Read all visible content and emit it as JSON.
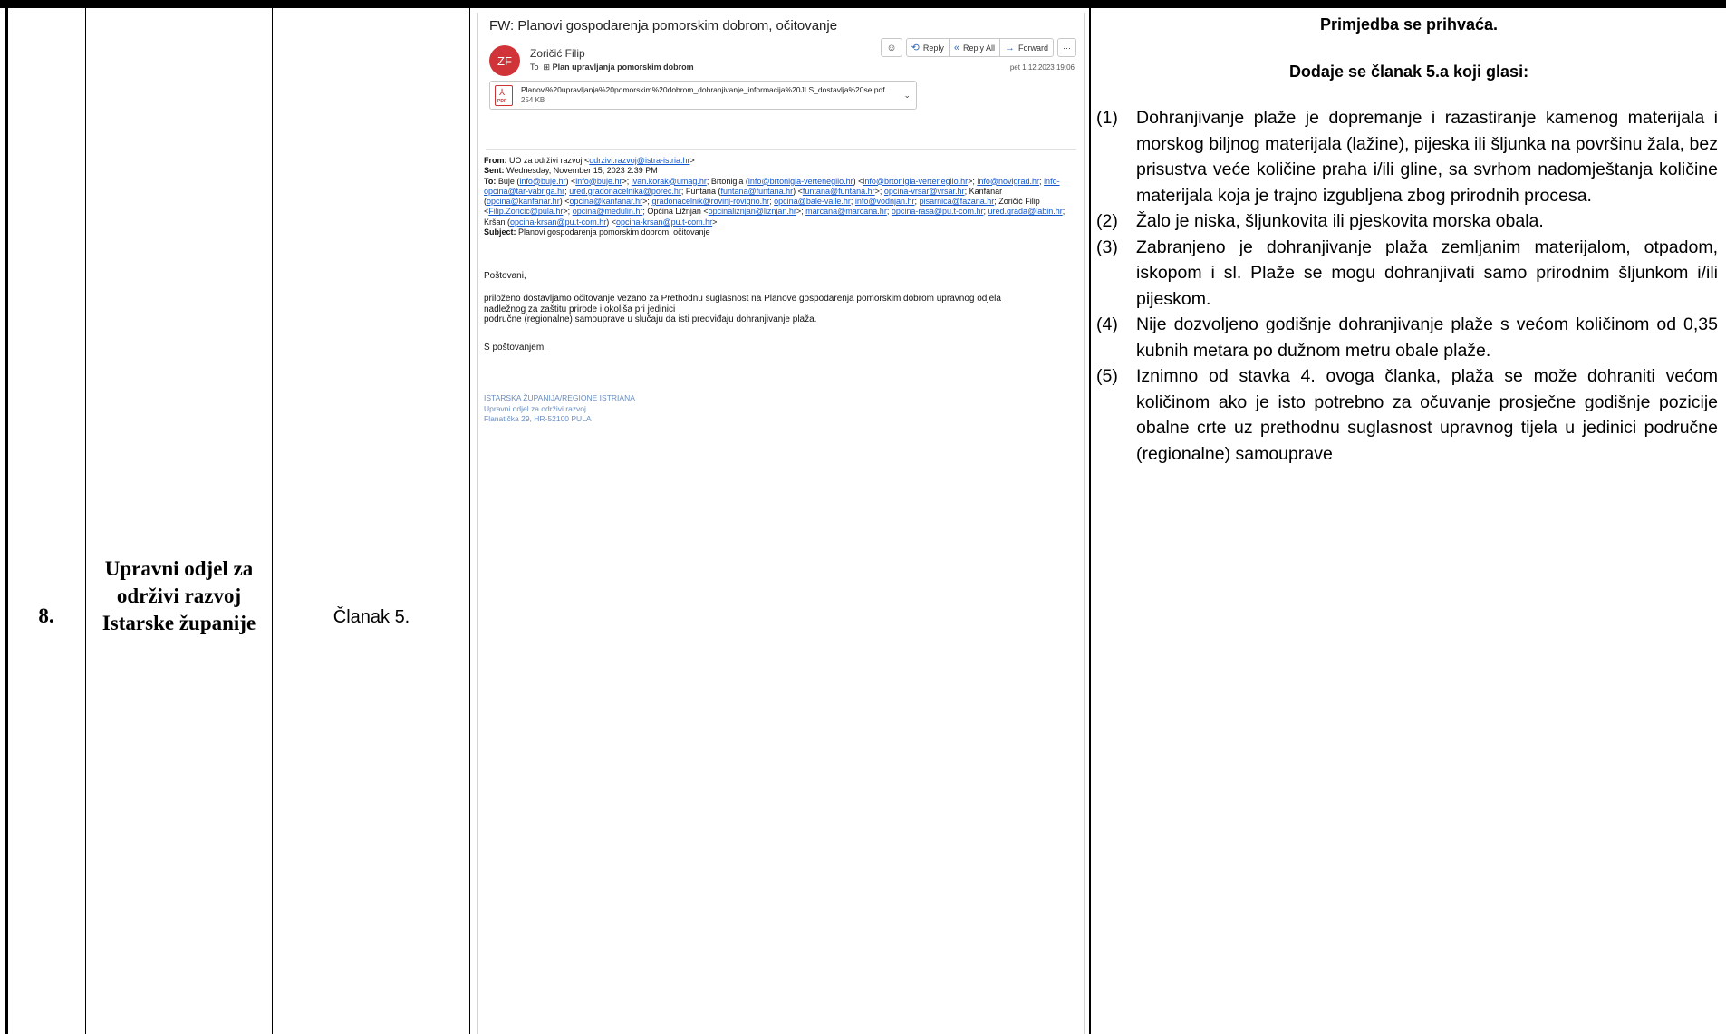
{
  "row": {
    "number": "8.",
    "authority": "Upravni odjel za održivi razvoj Istarske županije",
    "article": "Članak 5."
  },
  "email": {
    "subject": "FW: Planovi gospodarenja pomorskim dobrom, očitovanje",
    "avatar_initials": "ZF",
    "avatar_color": "#d13438",
    "sender": "Zoričić Filip",
    "to_label": "To",
    "to_value": "Plan upravljanja pomorskim dobrom",
    "buttons": {
      "emoji_icon": "smiley-icon",
      "reply": "Reply",
      "reply_all": "Reply All",
      "forward": "Forward",
      "more": "···"
    },
    "date": "pet 1.12.2023 19:06",
    "attachment": {
      "name": "Planovi%20upravljanja%20pomorskim%20dobrom_dohranjivanje_informacija%20JLS_dostavlja%20se.pdf",
      "size": "254 KB",
      "icon": "pdf-icon"
    },
    "headers": {
      "from_label": "From:",
      "from_value": "UO za održivi razvoj <",
      "from_link": "odrzivi.razvoj@istra-istria.hr",
      "from_end": ">",
      "sent_label": "Sent:",
      "sent_value": "Wednesday, November 15, 2023 2:39 PM",
      "to_label": "To:",
      "subject_label": "Subject:",
      "subject_value": "Planovi gospodarenja pomorskim dobrom, očitovanje"
    },
    "greeting": "Poštovani,",
    "body_line1": "priloženo dostavljamo očitovanje vezano za Prethodnu suglasnost na Planove gospodarenja pomorskim dobrom upravnog odjela",
    "body_line2": "nadležnog za zaštitu prirode i okoliša pri jedinici",
    "body_line3": "područne (regionalne) samouprave u slučaju da isti predviđaju dohranjivanje plaža.",
    "closing": "S poštovanjem,",
    "signature": {
      "line1": "ISTARSKA ŽUPANIJA/REGIONE ISTRIANA",
      "line2": "Upravni odjel za održivi razvoj",
      "line3": "Flanatička 29, HR-52100 PULA"
    }
  },
  "reply": {
    "accepted": "Primjedba se prihvaća.",
    "added": "Dodaje se članak 5.a koji glasi:",
    "items": [
      {
        "n": "(1)",
        "text": "Dohranjivanje plaže je dopremanje i razastiranje kamenog materijala i morskog biljnog materijala (lažine), pijeska ili šljunka na površinu žala, bez prisustva veće količine praha i/ili gline, sa svrhom nadomještanja količine materijala koja je trajno izgubljena zbog prirodnih procesa."
      },
      {
        "n": "(2)",
        "text": "Žalo je niska, šljunkovita ili pjeskovita morska obala."
      },
      {
        "n": "(3)",
        "text": "Zabranjeno je dohranjivanje plaža zemljanim materijalom, otpadom, iskopom i sl. Plaže se mogu dohranjivati samo prirodnim šljunkom i/ili pijeskom."
      },
      {
        "n": "(4)",
        "text": "Nije dozvoljeno godišnje dohranjivanje plaže s većom količinom od 0,35 kubnih metara po dužnom metru obale plaže."
      },
      {
        "n": "(5)",
        "text": "Iznimno od stavka 4. ovoga članka, plaža se može dohraniti većom količinom ako je isto potrebno za očuvanje prosječne godišnje pozicije obalne crte uz prethodnu suglasnost upravnog tijela u jedinici područne (regionalne) samouprave"
      }
    ]
  }
}
